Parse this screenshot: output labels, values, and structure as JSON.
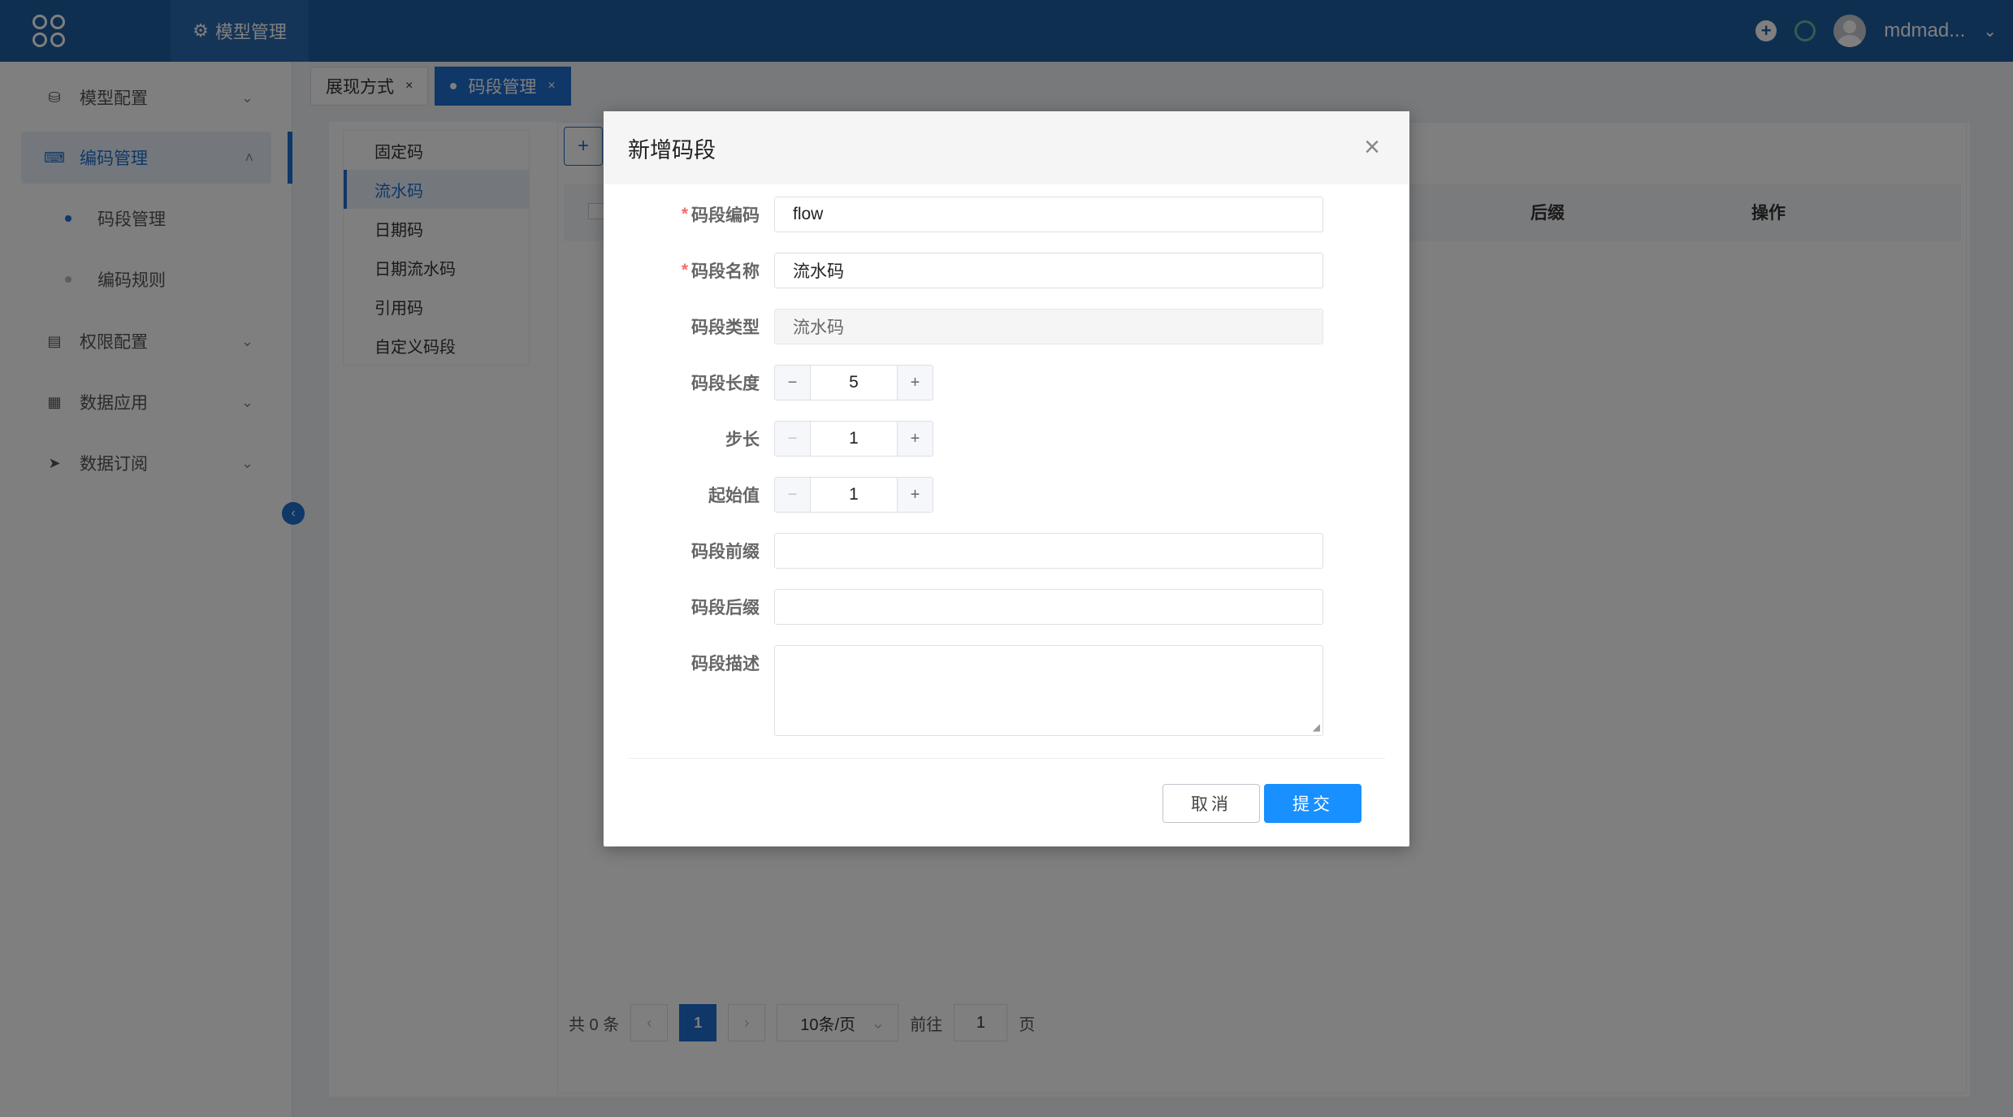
{
  "topbar": {
    "nav_tab": "模型管理",
    "username": "mdmad..."
  },
  "sidebar": {
    "items": [
      {
        "label": "模型配置"
      },
      {
        "label": "编码管理"
      },
      {
        "label": "权限配置"
      },
      {
        "label": "数据应用"
      },
      {
        "label": "数据订阅"
      }
    ],
    "sub_items": [
      {
        "label": "码段管理"
      },
      {
        "label": "编码规则"
      }
    ]
  },
  "tabs": [
    {
      "label": "展现方式"
    },
    {
      "label": "码段管理"
    }
  ],
  "type_list": [
    "固定码",
    "流水码",
    "日期码",
    "日期流水码",
    "引用码",
    "自定义码段"
  ],
  "table": {
    "headers": [
      "后缀",
      "操作"
    ]
  },
  "pager": {
    "total": "共 0 条",
    "current": "1",
    "page_size": "10条/页",
    "goto_label": "前往",
    "goto_value": "1",
    "page_unit": "页"
  },
  "dialog": {
    "title": "新增码段",
    "fields": {
      "code": {
        "label": "码段编码",
        "value": "flow"
      },
      "name": {
        "label": "码段名称",
        "value": "流水码"
      },
      "type": {
        "label": "码段类型",
        "value": "流水码"
      },
      "length": {
        "label": "码段长度",
        "value": "5"
      },
      "step": {
        "label": "步长",
        "value": "1"
      },
      "start": {
        "label": "起始值",
        "value": "1"
      },
      "prefix": {
        "label": "码段前缀",
        "value": ""
      },
      "suffix": {
        "label": "码段后缀",
        "value": ""
      },
      "desc": {
        "label": "码段描述",
        "value": ""
      }
    },
    "cancel_label": "取消",
    "submit_label": "提交"
  }
}
